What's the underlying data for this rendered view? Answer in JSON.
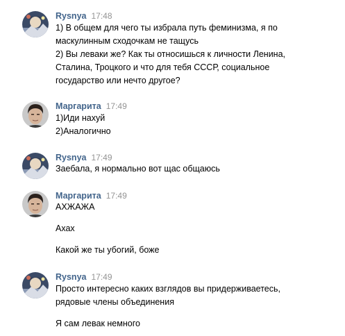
{
  "messages": [
    {
      "author": "Rysnya",
      "time": "17:48",
      "avatar": "rysnya-avatar",
      "lines": [
        "1) В общем для чего ты избрала путь феминизма, я по",
        "маскулинным сходочкам не тащусь",
        "2) Вы леваки же? Как ты относишься к личности Ленина,",
        "Сталина, Троцкого и что для тебя СССР, социальное",
        "государство или нечто другое?"
      ]
    },
    {
      "author": "Маргарита",
      "time": "17:49",
      "avatar": "margarita-avatar",
      "lines": [
        "1)Иди нахуй",
        "2)Аналогично"
      ]
    },
    {
      "author": "Rysnya",
      "time": "17:49",
      "avatar": "rysnya-avatar",
      "lines": [
        "Заебала, я нормально вот щас общаюсь"
      ]
    },
    {
      "author": "Маргарита",
      "time": "17:49",
      "avatar": "margarita-avatar",
      "lines": [
        "АХЖАЖА",
        "Ахах",
        "Какой же ты убогий, боже"
      ]
    },
    {
      "author": "Rysnya",
      "time": "17:49",
      "avatar": "rysnya-avatar",
      "lines": [
        "Просто интересно каких взглядов вы придерживаетесь,",
        "рядовые члены объединения",
        "Я сам левак немного"
      ]
    }
  ],
  "colors": {
    "author": "#42648b",
    "time": "#939393",
    "text": "#000000",
    "background": "#ffffff"
  }
}
